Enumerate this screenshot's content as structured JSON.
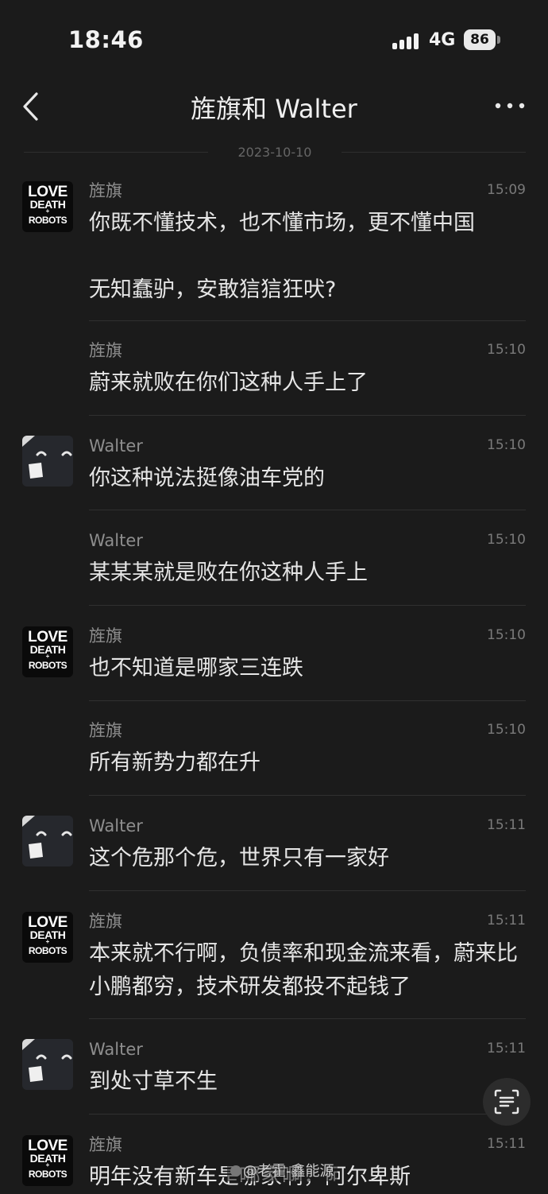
{
  "status": {
    "time": "18:46",
    "network": "4G",
    "battery": "86"
  },
  "header": {
    "title": "旌旗和 Walter"
  },
  "date_separator": "2023-10-10",
  "avatars": {
    "love_death_robots": [
      "LOVE",
      "DEATH",
      "+",
      "ROBOTS"
    ]
  },
  "messages": [
    {
      "sender": "旌旗",
      "time": "15:09",
      "text": "你既不懂技术，也不懂市场，更不懂中国\n\n无知蠢驴，安敢狺狺狂吠?"
    },
    {
      "sender": "旌旗",
      "time": "15:10",
      "text": "蔚来就败在你们这种人手上了"
    },
    {
      "sender": "Walter",
      "time": "15:10",
      "text": "你这种说法挺像油车党的"
    },
    {
      "sender": "Walter",
      "time": "15:10",
      "text": "某某某就是败在你这种人手上"
    },
    {
      "sender": "旌旗",
      "time": "15:10",
      "text": "也不知道是哪家三连跌"
    },
    {
      "sender": "旌旗",
      "time": "15:10",
      "text": "所有新势力都在升"
    },
    {
      "sender": "Walter",
      "time": "15:11",
      "text": "这个危那个危，世界只有一家好"
    },
    {
      "sender": "旌旗",
      "time": "15:11",
      "text": "本来就不行啊，负债率和现金流来看，蔚来比小鹏都穷，技术研发都投不起钱了"
    },
    {
      "sender": "Walter",
      "time": "15:11",
      "text": "到处寸草不生"
    },
    {
      "sender": "旌旗",
      "time": "15:11",
      "text": "明年没有新车是哪家啊，阿尔卑斯"
    }
  ],
  "watermark": "@老霍-鑫能源",
  "icons": {
    "back": "chevron-left-icon",
    "more": "more-dots-icon",
    "scan": "scan-text-icon",
    "signal": "signal-bars-icon",
    "battery": "battery-icon"
  }
}
